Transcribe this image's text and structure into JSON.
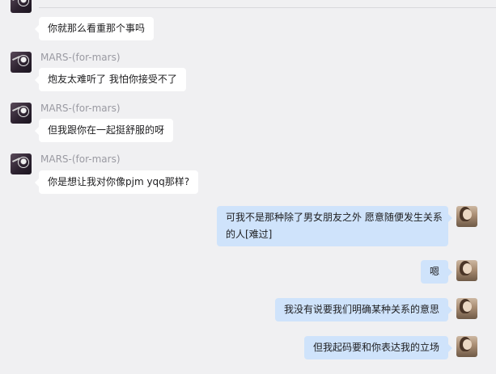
{
  "messages": [
    {
      "side": "left",
      "text": "你就那么看重那个事吗"
    },
    {
      "side": "left",
      "sender": "MARS-(for-mars)",
      "text": "炮友太难听了 我怕你接受不了"
    },
    {
      "side": "left",
      "sender": "MARS-(for-mars)",
      "text": "但我跟你在一起挺舒服的呀"
    },
    {
      "side": "left",
      "sender": "MARS-(for-mars)",
      "text": "你是想让我对你像pjm yqq那样?"
    },
    {
      "side": "right",
      "lines": [
        "可我不是那种除了男女朋友之外 愿意随便发生关系",
        "的人[难过]"
      ]
    },
    {
      "side": "right",
      "text": "嗯"
    },
    {
      "side": "right",
      "text": "我没有说要我们明确某种关系的意思"
    },
    {
      "side": "right",
      "text": "但我起码要和你表达我的立场"
    }
  ],
  "colors": {
    "background": "#f0f0f2",
    "incoming_bubble": "#ffffff",
    "outgoing_bubble": "#cfe3fb",
    "sender_name": "#9a9aa2"
  },
  "icons": {
    "left_avatar": "mars-avatar-icon",
    "right_avatar": "user-avatar-icon"
  }
}
